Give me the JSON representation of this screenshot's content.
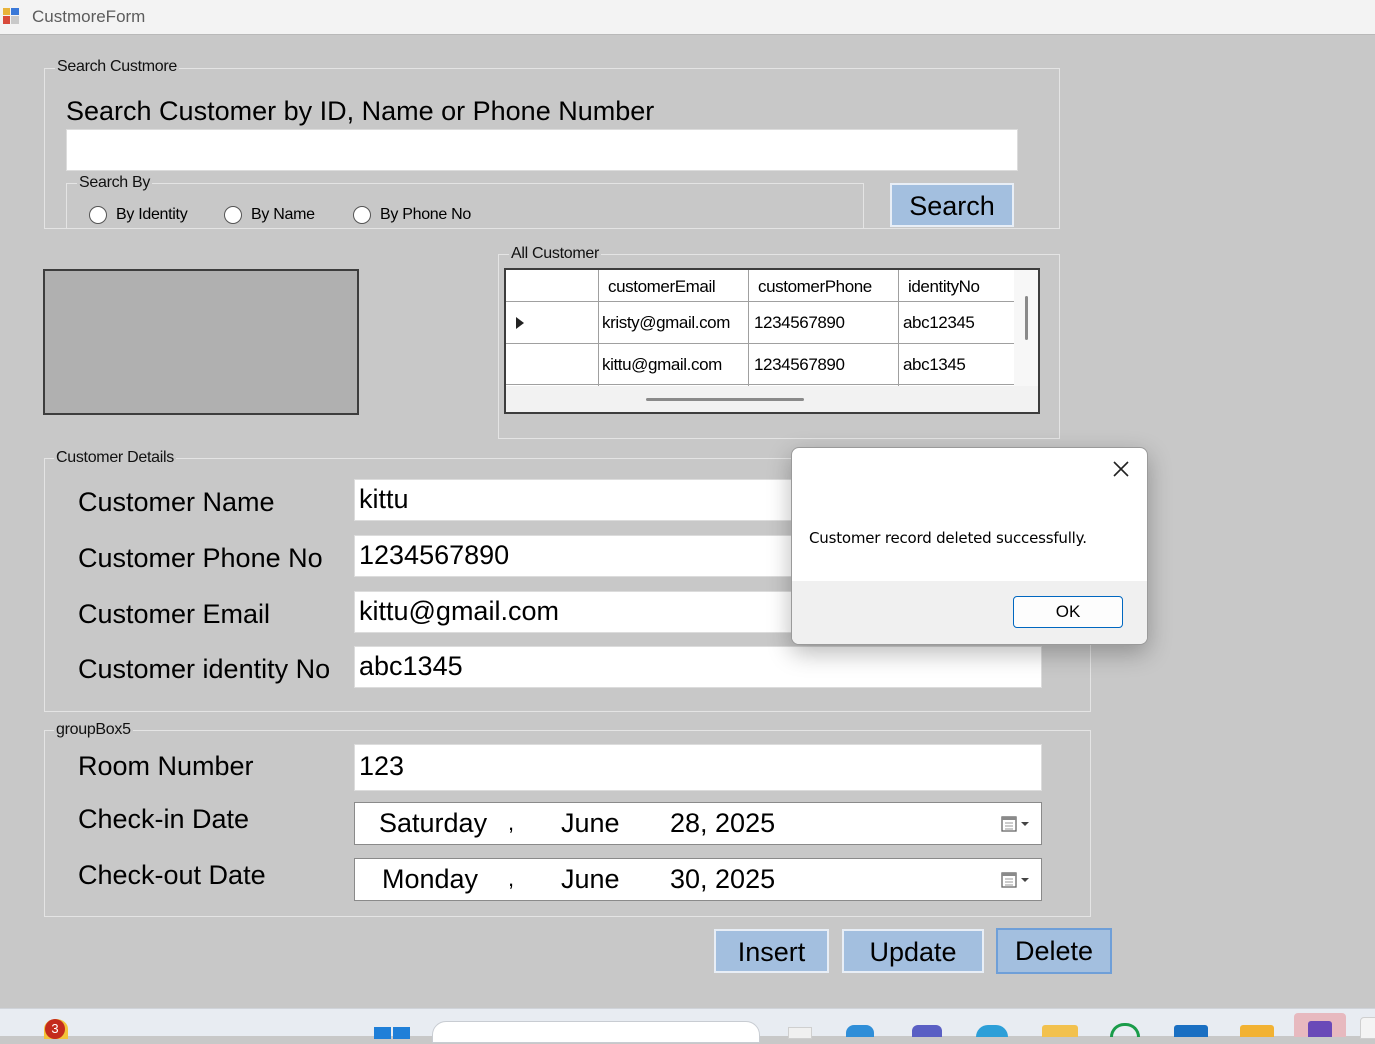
{
  "window": {
    "title": "CustmoreForm"
  },
  "search_group": {
    "legend": "Search Custmore",
    "heading": "Search Customer by ID, Name or Phone Number",
    "search_value": "",
    "search_by_legend": "Search By",
    "radios": [
      "By Identity",
      "By Name",
      "By Phone No"
    ],
    "search_button": "Search"
  },
  "all_customer": {
    "legend": "All Customer",
    "columns": [
      "customerEmail",
      "customerPhone",
      "identityNo"
    ],
    "rows": [
      {
        "email": "kristy@gmail.com",
        "phone": "1234567890",
        "identity": "abc12345",
        "selected": true
      },
      {
        "email": "kittu@gmail.com",
        "phone": "1234567890",
        "identity": "abc1345",
        "selected": false
      }
    ]
  },
  "details": {
    "legend": "Customer Details",
    "name_label": "Customer Name",
    "name_value": "kittu",
    "phone_label": "Customer Phone No",
    "phone_value": "1234567890",
    "email_label": "Customer Email",
    "email_value": "kittu@gmail.com",
    "identity_label": "Customer identity No",
    "identity_value": "abc1345"
  },
  "room": {
    "legend": "groupBox5",
    "room_label": "Room Number",
    "room_value": "123",
    "checkin_label": "Check-in Date",
    "checkin": {
      "day": "Saturday",
      "sep": ",",
      "month": "June",
      "date": "28, 2025"
    },
    "checkout_label": "Check-out Date",
    "checkout": {
      "day": "Monday",
      "sep": ",",
      "month": "June",
      "date": "30, 2025"
    }
  },
  "actions": {
    "insert": "Insert",
    "update": "Update",
    "delete": "Delete"
  },
  "dialog": {
    "message": "Customer record deleted successfully.",
    "ok": "OK"
  },
  "taskbar": {
    "badge": "3"
  },
  "colors": {
    "form_bg": "#c8c8c8",
    "button_bg": "#a3bfdf",
    "dialog_accent": "#0067c0"
  }
}
